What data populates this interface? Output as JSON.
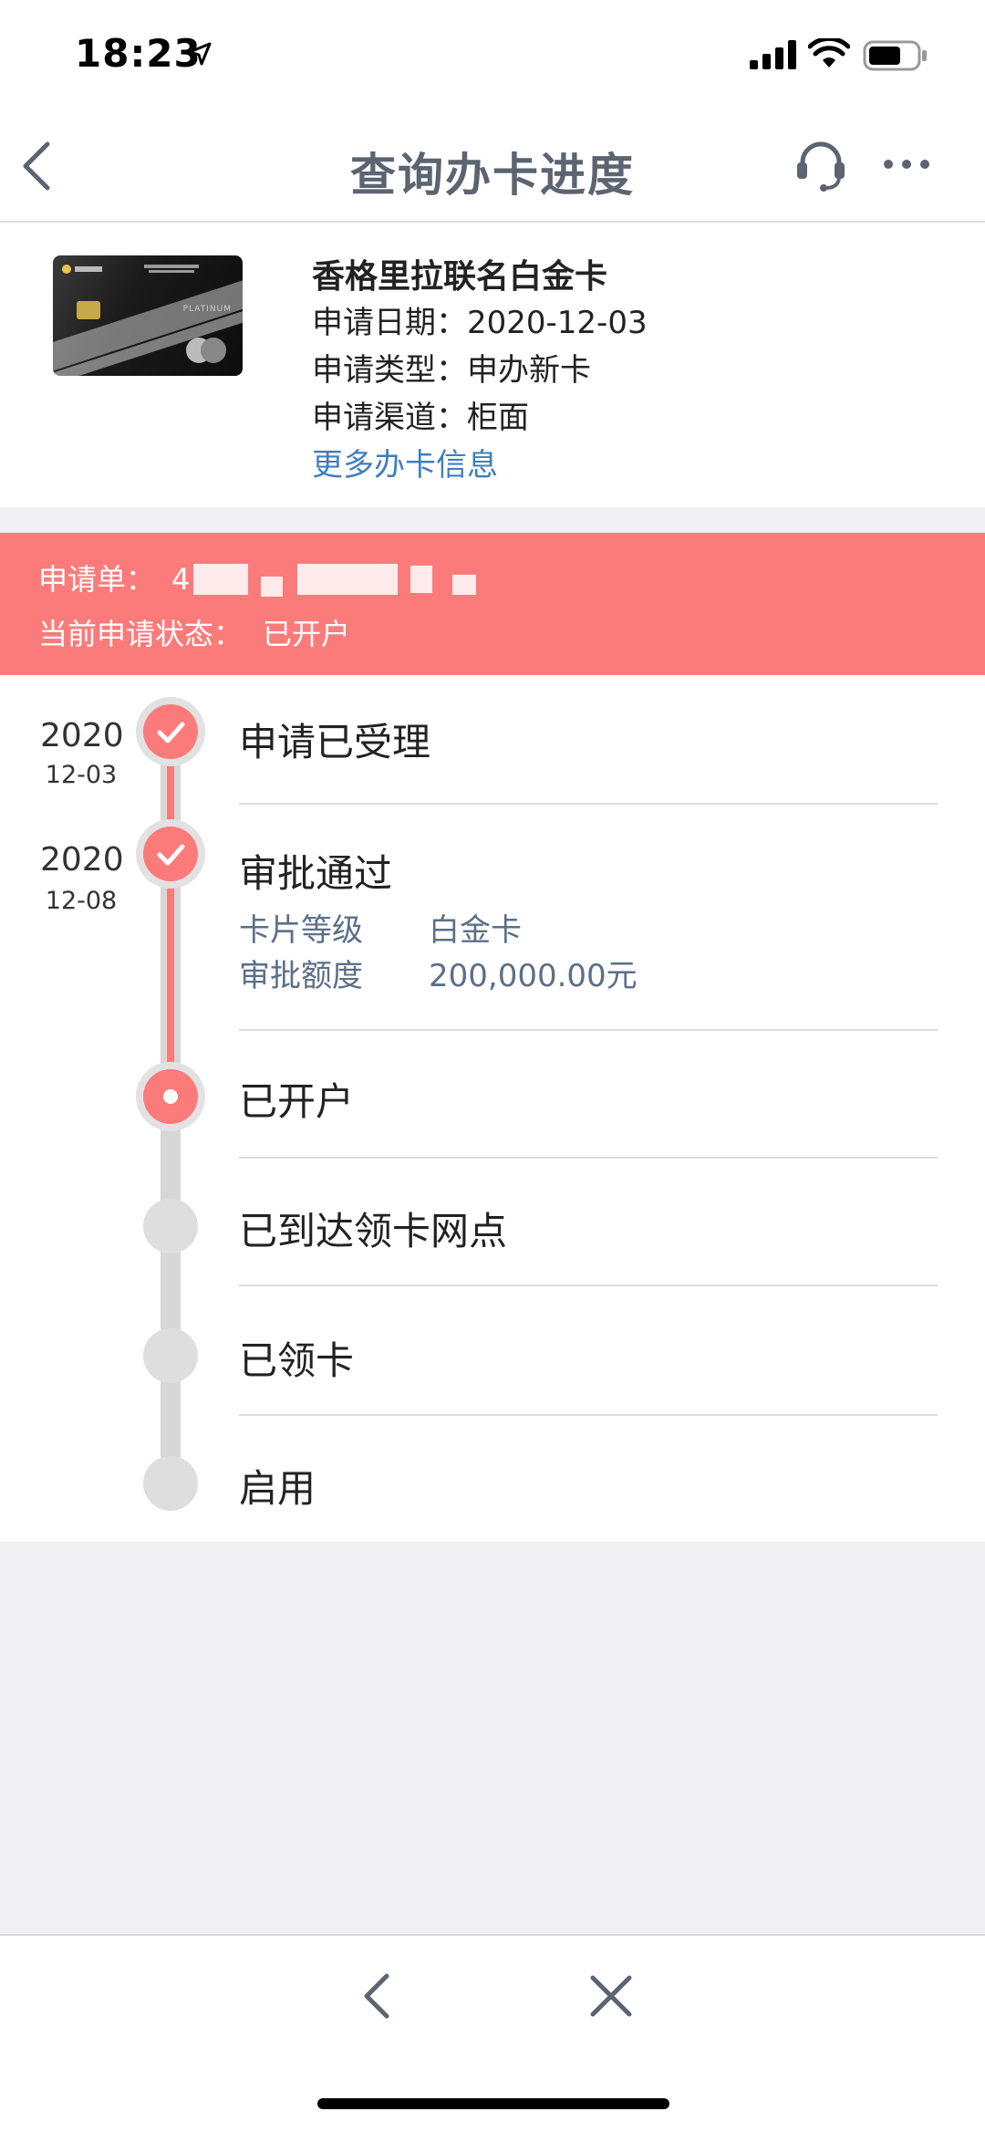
{
  "status_bar": {
    "time": "18:23"
  },
  "nav": {
    "title": "查询办卡进度"
  },
  "card": {
    "name": "香格里拉联名白金卡",
    "rows": [
      {
        "label": "申请日期：",
        "value": "2020-12-03"
      },
      {
        "label": "申请类型：",
        "value": "申办新卡"
      },
      {
        "label": "申请渠道：",
        "value": "柜面"
      }
    ],
    "more_link": "更多办卡信息",
    "image_text": {
      "brand": "ICBC",
      "tier": "PLATINUM"
    }
  },
  "application": {
    "number_label": "申请单：",
    "number_value": "4",
    "status_label": "当前申请状态：",
    "status_value": "已开户"
  },
  "timeline": {
    "steps": [
      {
        "title": "申请已受理",
        "year": "2020",
        "date": "12-03",
        "state": "done"
      },
      {
        "title": "审批通过",
        "year": "2020",
        "date": "12-08",
        "state": "done",
        "details": [
          {
            "label": "卡片等级",
            "value": "白金卡"
          },
          {
            "label": "审批额度",
            "value": "200,000.00元"
          }
        ]
      },
      {
        "title": "已开户",
        "state": "current"
      },
      {
        "title": "已到达领卡网点",
        "state": "pending"
      },
      {
        "title": "已领卡",
        "state": "pending"
      },
      {
        "title": "启用",
        "state": "pending"
      }
    ]
  },
  "colors": {
    "accent": "#fb7b7b",
    "link": "#3d7fc0",
    "title": "#5b6470",
    "detail": "#5b6f88"
  }
}
